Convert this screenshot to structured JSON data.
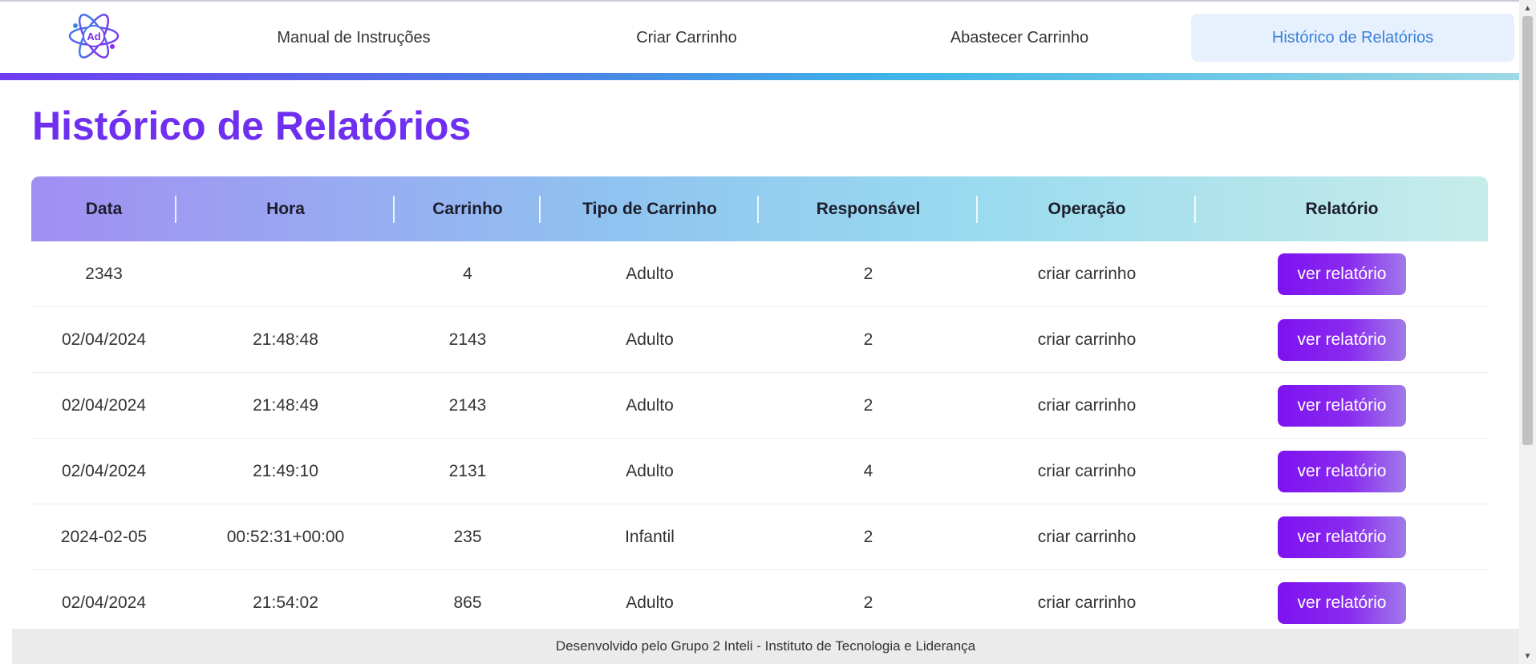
{
  "nav": {
    "logo_text": "Ad",
    "items": [
      {
        "label": "Manual de Instruções"
      },
      {
        "label": "Criar Carrinho"
      },
      {
        "label": "Abastecer Carrinho"
      },
      {
        "label": "Histórico de Relatórios"
      }
    ],
    "active_index": 3
  },
  "page": {
    "title": "Histórico de Relatórios"
  },
  "table": {
    "headers": [
      "Data",
      "Hora",
      "Carrinho",
      "Tipo de Carrinho",
      "Responsável",
      "Operação",
      "Relatório"
    ],
    "button_label": "ver relatório",
    "rows": [
      {
        "data": "2343",
        "hora": "",
        "carrinho": "4",
        "tipo": "Adulto",
        "responsavel": "2",
        "operacao": "criar carrinho"
      },
      {
        "data": "02/04/2024",
        "hora": "21:48:48",
        "carrinho": "2143",
        "tipo": "Adulto",
        "responsavel": "2",
        "operacao": "criar carrinho"
      },
      {
        "data": "02/04/2024",
        "hora": "21:48:49",
        "carrinho": "2143",
        "tipo": "Adulto",
        "responsavel": "2",
        "operacao": "criar carrinho"
      },
      {
        "data": "02/04/2024",
        "hora": "21:49:10",
        "carrinho": "2131",
        "tipo": "Adulto",
        "responsavel": "4",
        "operacao": "criar carrinho"
      },
      {
        "data": "2024-02-05",
        "hora": "00:52:31+00:00",
        "carrinho": "235",
        "tipo": "Infantil",
        "responsavel": "2",
        "operacao": "criar carrinho"
      },
      {
        "data": "02/04/2024",
        "hora": "21:54:02",
        "carrinho": "865",
        "tipo": "Adulto",
        "responsavel": "2",
        "operacao": "criar carrinho"
      }
    ]
  },
  "footer": {
    "text": "Desenvolvido pelo Grupo 2 Inteli - Instituto de Tecnologia e Liderança"
  },
  "colors": {
    "title": "#6f2ff0",
    "active_nav_bg": "#e6f1fd",
    "active_nav_text": "#3d7fd9",
    "button": "#7d12f0"
  },
  "icons": {
    "logo": "atom-logo-icon",
    "scroll_up": "triangle-up-icon",
    "scroll_down": "triangle-down-icon"
  }
}
